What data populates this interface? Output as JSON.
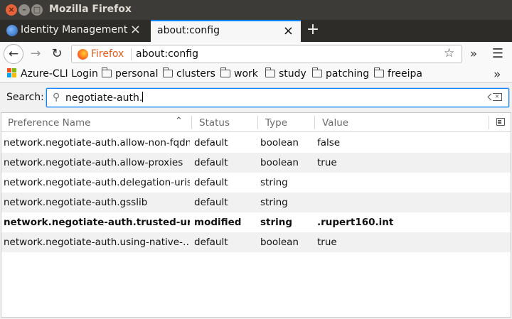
{
  "window": {
    "title": "Mozilla Firefox"
  },
  "tabs": [
    {
      "label": "Identity Management",
      "active": false
    },
    {
      "label": "about:config",
      "active": true
    }
  ],
  "toolbar": {
    "identity_label": "Firefox",
    "url": "about:config",
    "icons": [
      "back-arrow-icon",
      "forward-arrow-icon",
      "reload-icon",
      "star-icon",
      "overflow-chevron-icon",
      "hamburger-menu-icon"
    ]
  },
  "bookmarks": {
    "items": [
      {
        "label": "Azure-CLI Login",
        "icon": "microsoft-logo-icon"
      },
      {
        "label": "personal",
        "icon": "folder-icon"
      },
      {
        "label": "clusters",
        "icon": "folder-icon"
      },
      {
        "label": "work",
        "icon": "folder-icon"
      },
      {
        "label": "study",
        "icon": "folder-icon"
      },
      {
        "label": "patching",
        "icon": "folder-icon"
      },
      {
        "label": "freeipa",
        "icon": "folder-icon"
      }
    ],
    "overflow_glyph": "»"
  },
  "config": {
    "search": {
      "label": "Search:",
      "value": "negotiate-auth."
    },
    "columns": {
      "name": "Preference Name",
      "status": "Status",
      "type": "Type",
      "value": "Value"
    },
    "rows": [
      {
        "name": "network.negotiate-auth.allow-non-fqdn",
        "status": "default",
        "type": "boolean",
        "value": "false",
        "modified": false
      },
      {
        "name": "network.negotiate-auth.allow-proxies",
        "status": "default",
        "type": "boolean",
        "value": "true",
        "modified": false
      },
      {
        "name": "network.negotiate-auth.delegation-uris",
        "status": "default",
        "type": "string",
        "value": "",
        "modified": false
      },
      {
        "name": "network.negotiate-auth.gsslib",
        "status": "default",
        "type": "string",
        "value": "",
        "modified": false
      },
      {
        "name": "network.negotiate-auth.trusted-uris",
        "status": "modified",
        "type": "string",
        "value": ".rupert160.int",
        "modified": true
      },
      {
        "name": "network.negotiate-auth.using-native-…",
        "status": "default",
        "type": "boolean",
        "value": "true",
        "modified": false
      }
    ]
  },
  "colors": {
    "accent": "#0a84ff",
    "titlebar": "#3c3b37",
    "tabstrip": "#2d2c29",
    "firefox_label": "#e35c1d",
    "close_button": "#e6623a"
  }
}
